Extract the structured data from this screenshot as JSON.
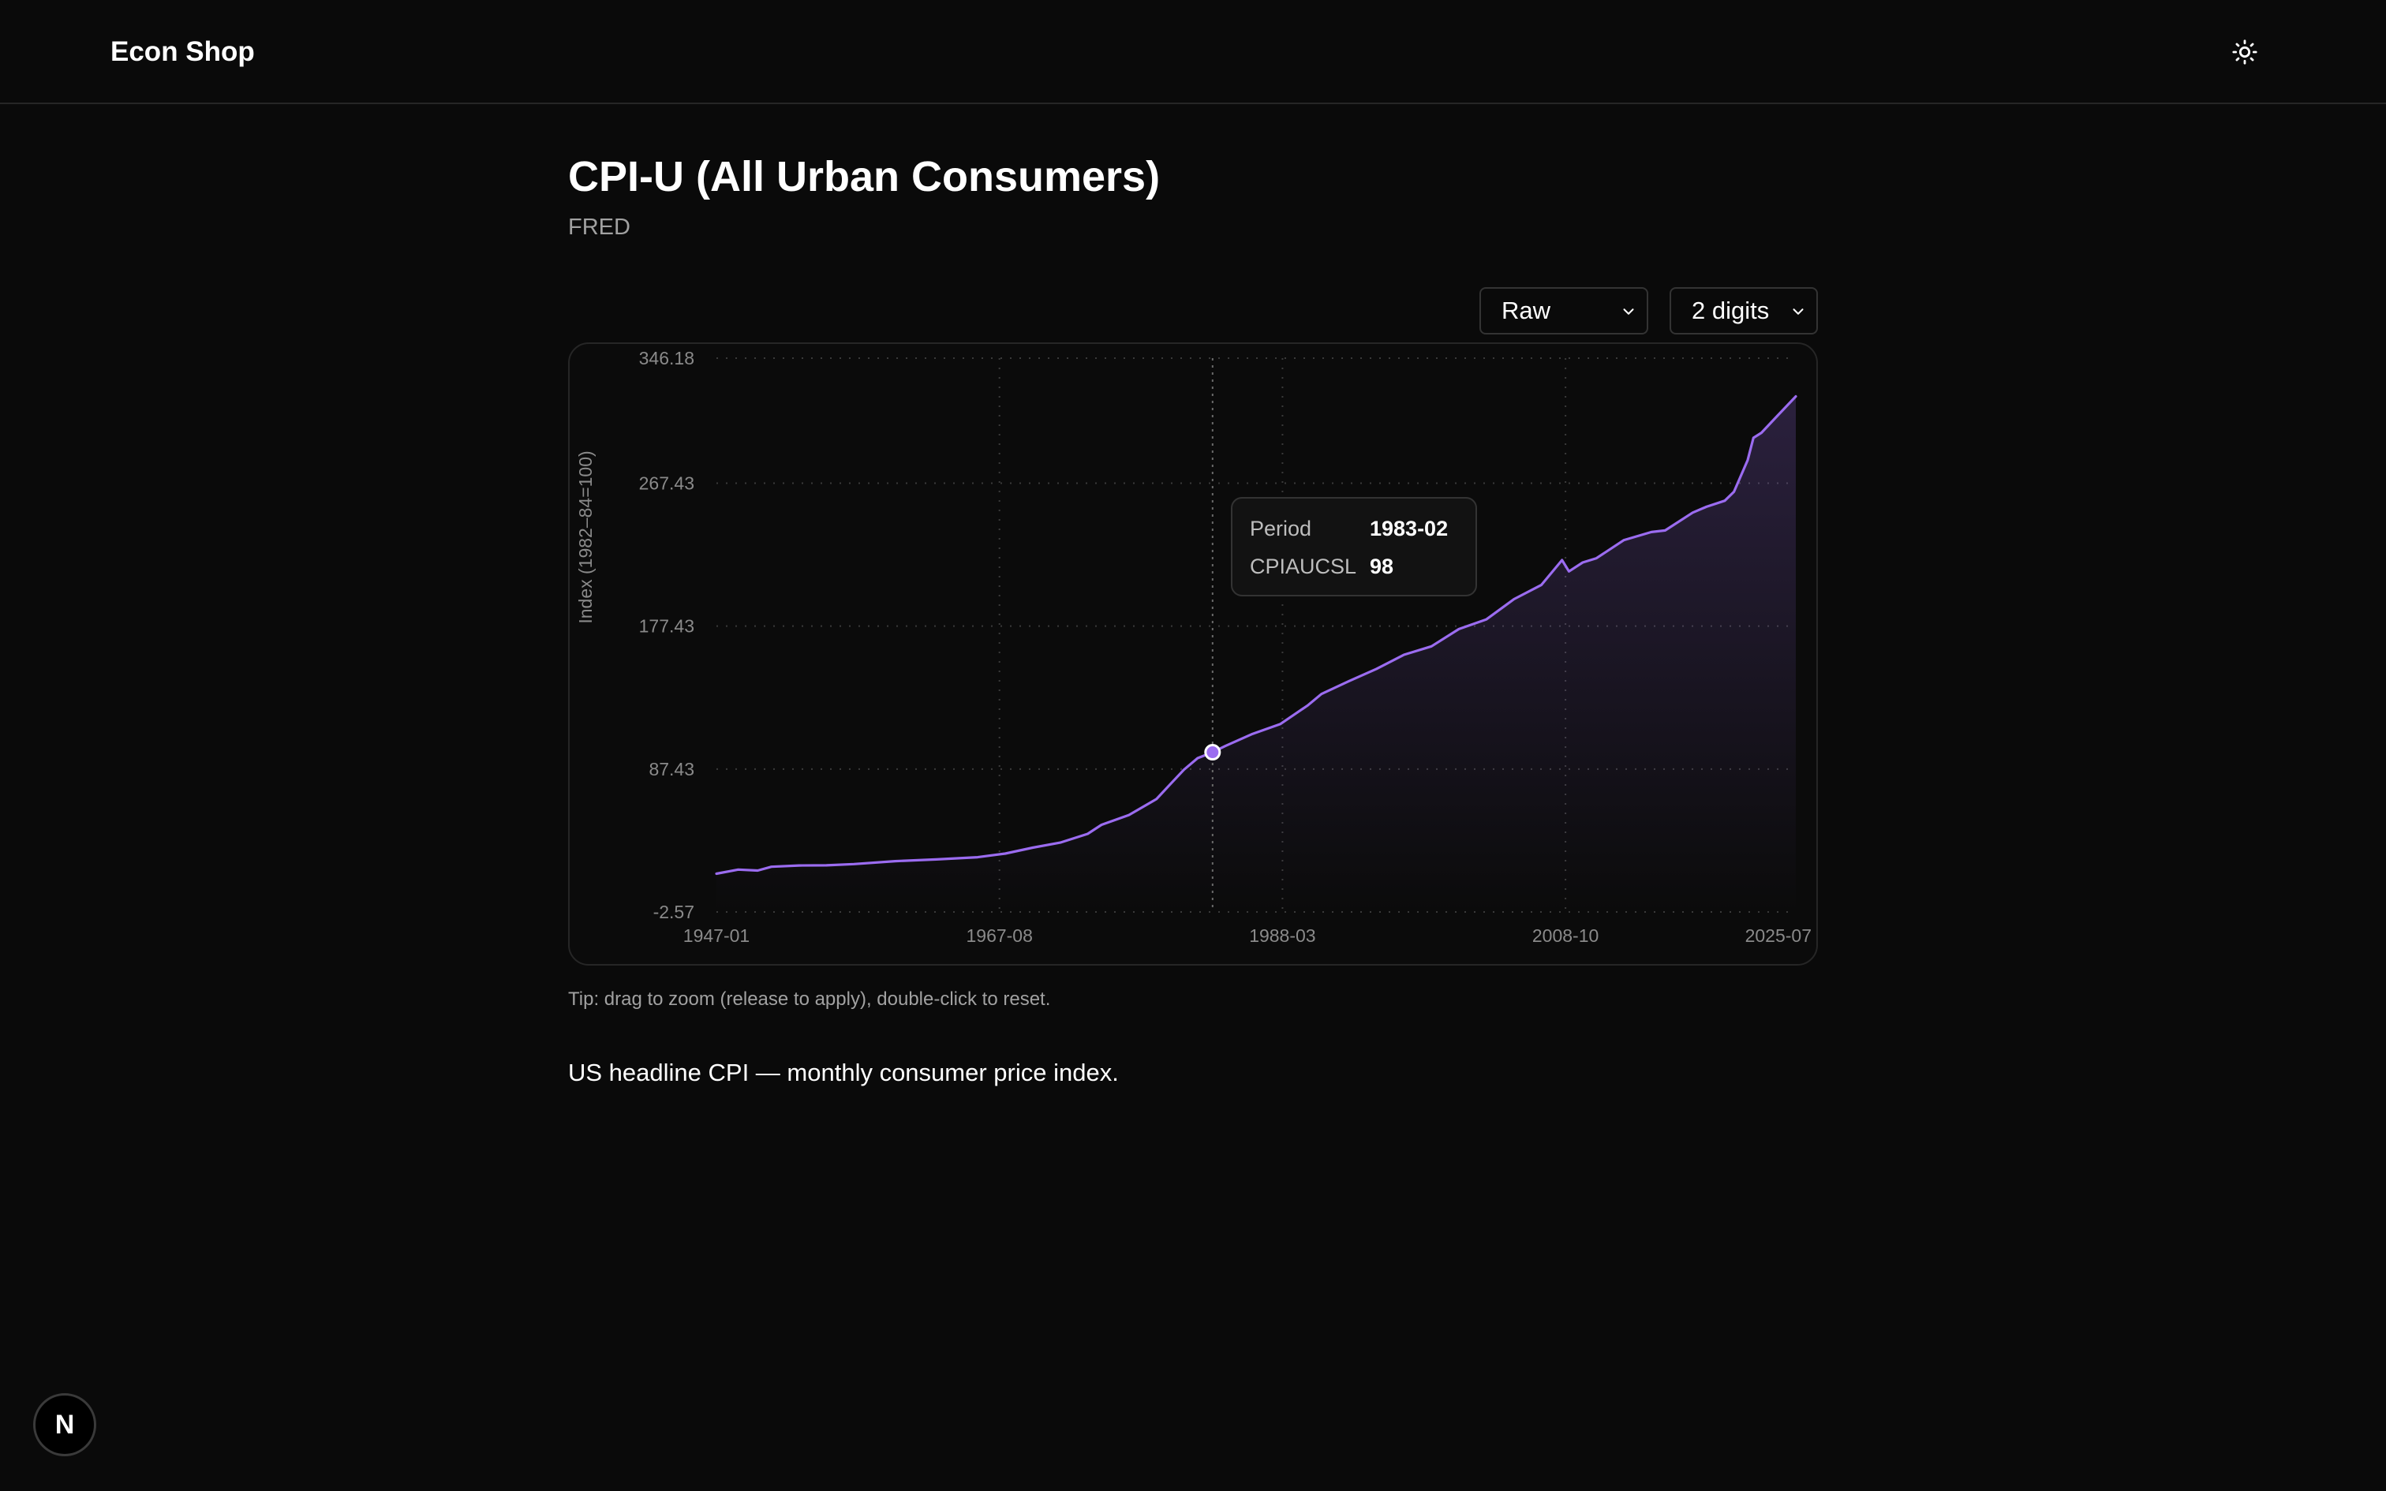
{
  "header": {
    "brand": "Econ Shop",
    "theme_icon": "sun-icon"
  },
  "page": {
    "title": "CPI-U (All Urban Consumers)",
    "source": "FRED",
    "tip": "Tip: drag to zoom (release to apply), double-click to reset.",
    "description": "US headline CPI — monthly consumer price index."
  },
  "controls": {
    "mode": {
      "selected": "Raw"
    },
    "digits": {
      "selected": "2 digits"
    }
  },
  "tooltip": {
    "period_label": "Period",
    "period_value": "1983-02",
    "series_label": "CPIAUCSL",
    "series_value": "98"
  },
  "footer": {
    "badge_letter": "N",
    "badge_icon": "nextjs-logo-icon"
  },
  "colors": {
    "background": "#0a0a0a",
    "line": "#9b6cf0",
    "grid": "#3a3a3a",
    "tick": "#8a8a8a"
  },
  "chart_data": {
    "type": "area",
    "ylabel": "Index (1982–84=100)",
    "xlabel": "",
    "x_range": [
      "1947-01",
      "2025-07"
    ],
    "ylim": [
      -2.57,
      346.18
    ],
    "y_ticks": [
      "346.18",
      "267.43",
      "177.43",
      "87.43",
      "-2.57"
    ],
    "y_tick_values": [
      346.18,
      267.43,
      177.43,
      87.43,
      -2.57
    ],
    "x_ticks": [
      "1947-01",
      "1967-08",
      "1988-03",
      "2008-10",
      "2025-07"
    ],
    "grid": true,
    "hover_point": {
      "x": "1983-02",
      "y": 98
    },
    "series": [
      {
        "name": "CPIAUCSL",
        "x": [
          "1947-01",
          "1948-08",
          "1950-01",
          "1951-01",
          "1953-01",
          "1955-01",
          "1957-01",
          "1960-01",
          "1963-01",
          "1966-01",
          "1968-01",
          "1970-01",
          "1972-01",
          "1974-01",
          "1975-01",
          "1977-01",
          "1979-01",
          "1980-01",
          "1981-01",
          "1982-01",
          "1983-02",
          "1984-01",
          "1986-01",
          "1988-01",
          "1990-01",
          "1991-01",
          "1993-01",
          "1995-01",
          "1997-01",
          "1999-01",
          "2001-01",
          "2003-01",
          "2005-01",
          "2007-01",
          "2008-07",
          "2009-01",
          "2010-01",
          "2011-01",
          "2013-01",
          "2015-01",
          "2016-01",
          "2018-01",
          "2019-01",
          "2020-05",
          "2021-01",
          "2022-01",
          "2022-06",
          "2023-01",
          "2024-01",
          "2025-07"
        ],
        "values": [
          21.5,
          24.1,
          23.5,
          25.9,
          26.7,
          26.8,
          27.6,
          29.4,
          30.5,
          31.9,
          34.2,
          37.9,
          41.1,
          46.6,
          52.3,
          58.5,
          68.5,
          77.8,
          87.0,
          94.3,
          98.0,
          101.9,
          109.6,
          115.7,
          127.5,
          134.7,
          142.8,
          150.5,
          159.4,
          164.7,
          175.6,
          181.7,
          194.4,
          203.4,
          219.0,
          211.9,
          217.5,
          220.2,
          231.6,
          236.7,
          237.7,
          248.9,
          252.6,
          256.4,
          262.0,
          282.0,
          296.0,
          299.2,
          308.4,
          322.1
        ]
      }
    ]
  }
}
